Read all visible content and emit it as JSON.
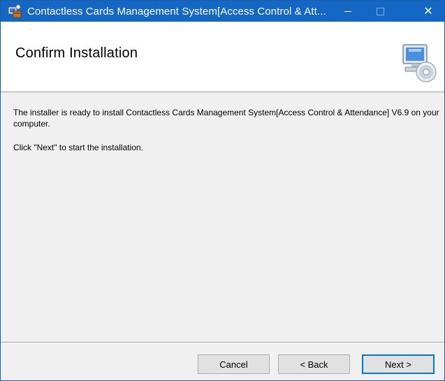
{
  "window": {
    "title": "Contactless Cards Management System[Access Control & Att..."
  },
  "title_controls": {
    "minimize_icon": "minimize-icon",
    "maximize_icon": "maximize-icon",
    "close_label": "✕"
  },
  "header": {
    "title": "Confirm Installation",
    "icon": "computer-cd-icon"
  },
  "body": {
    "paragraph1": "The installer is ready to install Contactless Cards Management System[Access Control & Attendance] V6.9 on your computer.",
    "paragraph2": "Click \"Next\" to start the installation."
  },
  "buttons": {
    "cancel": "Cancel",
    "back": "< Back",
    "next": "Next >"
  },
  "colors": {
    "titlebar": "#1567c6",
    "focus_border": "#0078d7"
  }
}
